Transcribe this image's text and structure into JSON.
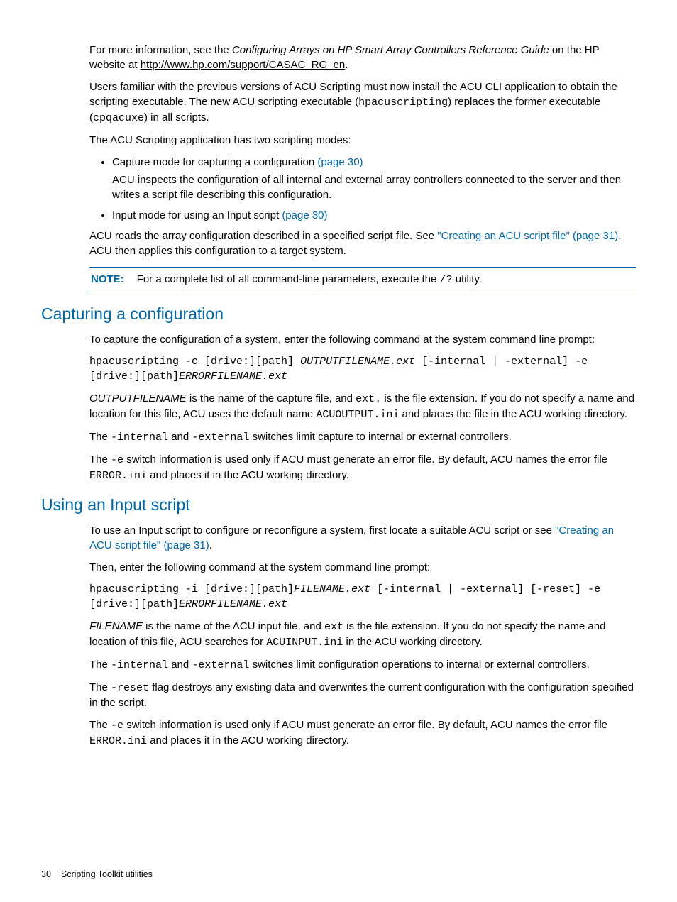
{
  "p1_a": "For more information, see the ",
  "p1_b": "Configuring Arrays on HP Smart Array Controllers Reference Guide",
  "p1_c": " on the HP website at ",
  "p1_link": "http://www.hp.com/support/CASAC_RG_en",
  "p1_d": ".",
  "p2_a": "Users familiar with the previous versions of ACU Scripting must now install the ACU CLI application to obtain the scripting executable. The new ACU scripting executable (",
  "p2_code1": "hpacuscripting",
  "p2_b": ") replaces the former executable (",
  "p2_code2": "cpqacuxe",
  "p2_c": ") in all scripts.",
  "p3": "The ACU Scripting application has two scripting modes:",
  "li1_a": "Capture mode for capturing a configuration ",
  "li1_link": "(page 30)",
  "li1_sub": "ACU inspects the configuration of all internal and external array controllers connected to the server and then writes a script file describing this configuration.",
  "li2_a": "Input mode for using an Input script ",
  "li2_link": "(page 30)",
  "p4_a": "ACU reads the array configuration described in a specified script file. See ",
  "p4_link": "\"Creating an ACU script file\" (page 31)",
  "p4_b": ". ACU then applies this configuration to a target system.",
  "note_label": "NOTE:",
  "note_a": "For a complete list of all command-line parameters, execute the ",
  "note_code": "/?",
  "note_b": " utility.",
  "h_capture": "Capturing a configuration",
  "cap_p1": "To capture the configuration of a system, enter the following command at the system command line prompt:",
  "cap_code": "hpacuscripting -c [drive:][path] OUTPUTFILENAME.ext [-internal | -external] -e [drive:][path]ERRORFILENAME.ext",
  "cap_p2_a": "OUTPUTFILENAME",
  "cap_p2_b": " is the name of the capture file, and ",
  "cap_p2_c": "ext.",
  "cap_p2_d": " is the file extension. If you do not specify a name and location for this file, ACU uses the default name ",
  "cap_p2_e": "ACUOUTPUT.ini",
  "cap_p2_f": " and places the file in the ACU working directory.",
  "cap_p3_a": "The ",
  "cap_p3_b": "-internal",
  "cap_p3_c": " and ",
  "cap_p3_d": "-external",
  "cap_p3_e": " switches limit capture to internal or external controllers.",
  "cap_p4_a": "The ",
  "cap_p4_b": "-e",
  "cap_p4_c": " switch information is used only if ACU must generate an error file. By default, ACU names the error file ",
  "cap_p4_d": "ERROR.ini",
  "cap_p4_e": " and places it in the ACU working directory.",
  "h_input": "Using an Input script",
  "in_p1_a": "To use an Input script to configure or reconfigure a system, first locate a suitable ACU script or see ",
  "in_p1_link": "\"Creating an ACU script file\" (page 31)",
  "in_p1_b": ".",
  "in_p2": "Then, enter the following command at the system command line prompt:",
  "in_code": "hpacuscripting -i [drive:][path]FILENAME.ext [-internal | -external] [-reset] -e [drive:][path]ERRORFILENAME.ext",
  "in_p3_a": "FILENAME",
  "in_p3_b": " is the name of the ACU input file, and ",
  "in_p3_c": "ext",
  "in_p3_d": " is the file extension. If you do not specify the name and location of this file, ACU searches for ",
  "in_p3_e": "ACUINPUT.ini",
  "in_p3_f": " in the ACU working directory.",
  "in_p4_a": "The ",
  "in_p4_b": "-internal",
  "in_p4_c": " and ",
  "in_p4_d": "-external",
  "in_p4_e": " switches limit configuration operations to internal or external controllers.",
  "in_p5_a": "The ",
  "in_p5_b": "-reset",
  "in_p5_c": " flag destroys any existing data and overwrites the current configuration with the configuration specified in the script.",
  "in_p6_a": "The ",
  "in_p6_b": "-e",
  "in_p6_c": " switch information is used only if ACU must generate an error file. By default, ACU names the error file ",
  "in_p6_d": "ERROR.ini",
  "in_p6_e": " and places it in the ACU working directory.",
  "footer_page": "30",
  "footer_text": "Scripting Toolkit utilities"
}
